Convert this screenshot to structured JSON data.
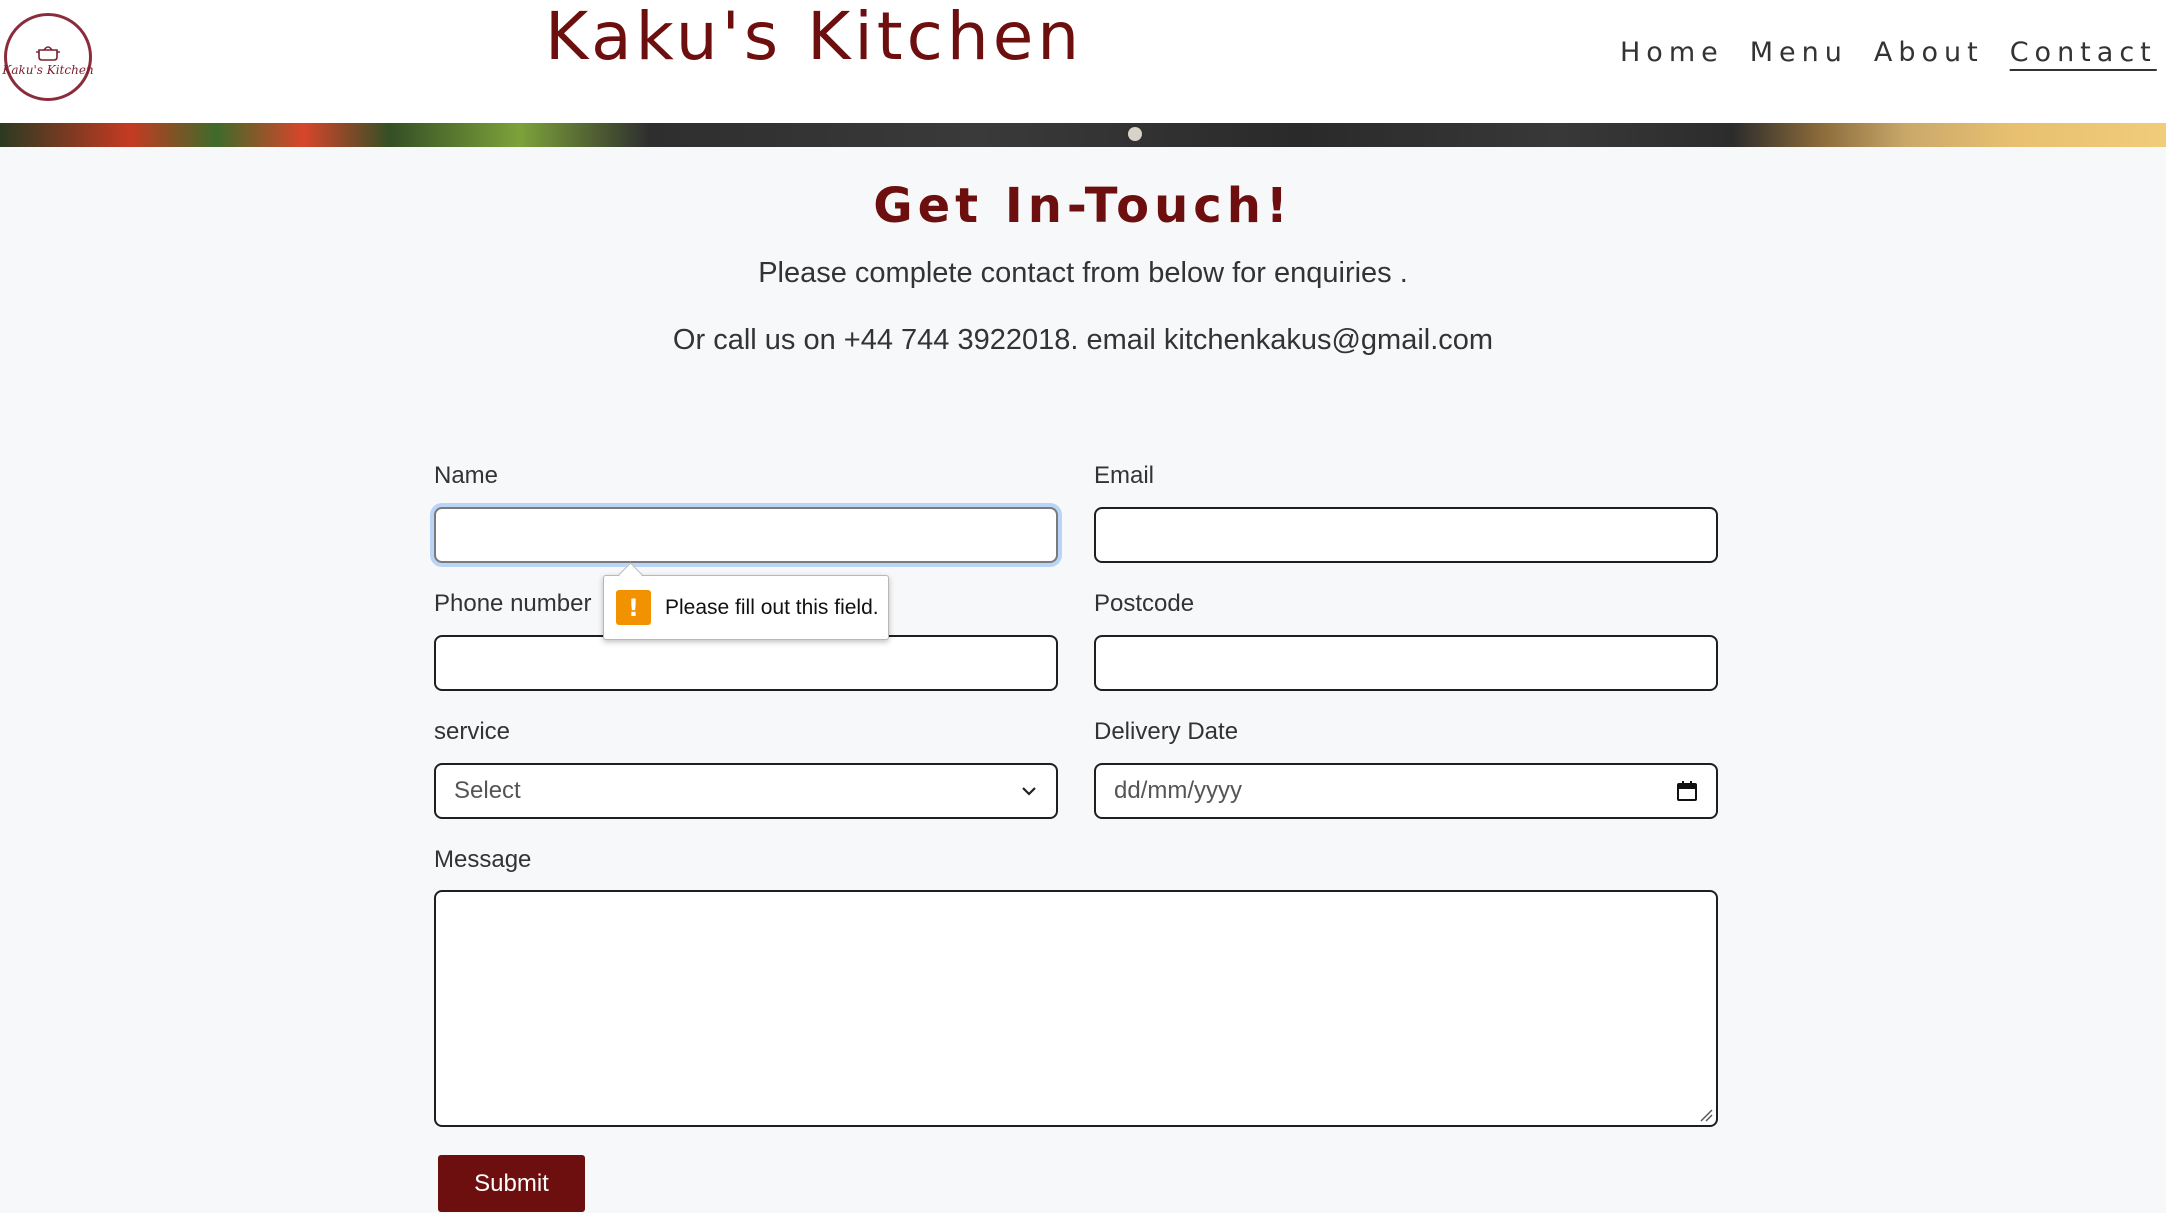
{
  "brand": {
    "title": "Kaku's Kitchen",
    "logo_text": "Kaku's Kitchen",
    "accent_color": "#6d0f0f"
  },
  "nav": {
    "items": [
      {
        "label": "Home",
        "active": false
      },
      {
        "label": "Menu",
        "active": false
      },
      {
        "label": "About",
        "active": false
      },
      {
        "label": "Contact",
        "active": true
      }
    ]
  },
  "contact": {
    "heading": "Get In-Touch!",
    "intro": "Please complete contact from below for enquiries .",
    "call_line": "Or call us on +44 744 3922018. email kitchenkakus@gmail.com"
  },
  "form": {
    "name_label": "Name",
    "email_label": "Email",
    "phone_label": "Phone number",
    "postcode_label": "Postcode",
    "service_label": "service",
    "service_value": "Select",
    "delivery_label": "Delivery Date",
    "delivery_placeholder": "dd/mm/yyyy",
    "message_label": "Message",
    "submit_label": "Submit"
  },
  "validation": {
    "message": "Please fill out this field.",
    "icon": "warning-icon",
    "icon_color": "#f39200"
  }
}
